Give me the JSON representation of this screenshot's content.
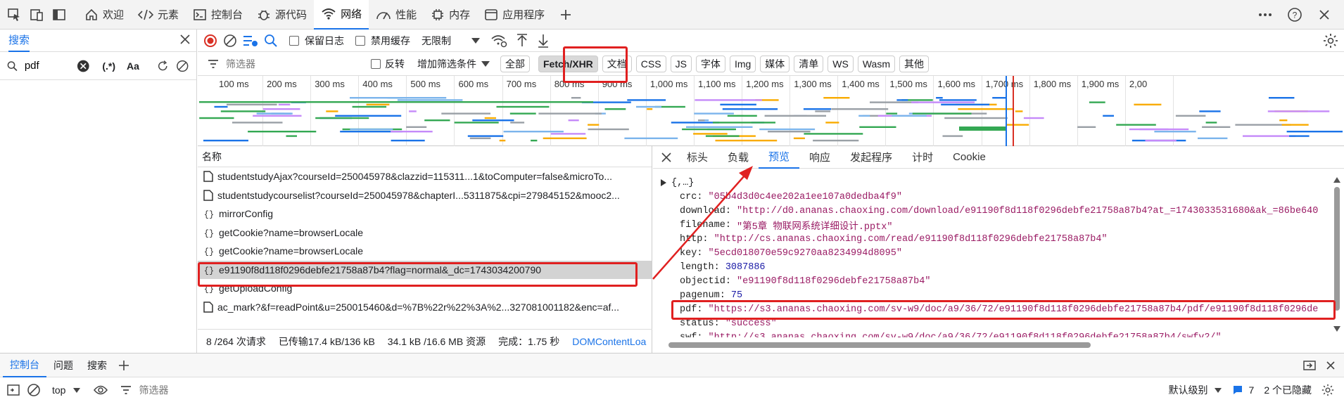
{
  "colors": {
    "accent": "#1a73e8",
    "annotation": "#e02020",
    "string": "#9a1b64",
    "number": "#1a1aa6"
  },
  "top_tabs": [
    {
      "label": "欢迎",
      "icon": "home-icon"
    },
    {
      "label": "元素",
      "icon": "code-icon"
    },
    {
      "label": "控制台",
      "icon": "console-icon"
    },
    {
      "label": "源代码",
      "icon": "bug-icon"
    },
    {
      "label": "网络",
      "icon": "wifi-icon",
      "active": true
    },
    {
      "label": "性能",
      "icon": "gauge-icon"
    },
    {
      "label": "内存",
      "icon": "chip-icon"
    },
    {
      "label": "应用程序",
      "icon": "window-icon"
    }
  ],
  "search_panel": {
    "tab": "搜索",
    "query": "pdf",
    "regex": "(.*)",
    "case": "Aa"
  },
  "toolbar": {
    "preserve_log": "保留日志",
    "disable_cache": "禁用缓存",
    "throttle": "无限制"
  },
  "filter": {
    "placeholder": "筛选器",
    "invert": "反转",
    "more": "增加筛选条件",
    "types": [
      "全部",
      "Fetch/XHR",
      "文档",
      "CSS",
      "JS",
      "字体",
      "Img",
      "媒体",
      "清单",
      "WS",
      "Wasm",
      "其他"
    ],
    "selected": "Fetch/XHR"
  },
  "timeline_ticks": [
    "100 ms",
    "200 ms",
    "300 ms",
    "400 ms",
    "500 ms",
    "600 ms",
    "700 ms",
    "800 ms",
    "900 ms",
    "1,000 ms",
    "1,100 ms",
    "1,200 ms",
    "1,300 ms",
    "1,400 ms",
    "1,500 ms",
    "1,600 ms",
    "1,700 ms",
    "1,800 ms",
    "1,900 ms",
    "2,00"
  ],
  "requests": {
    "header": "名称",
    "items": [
      {
        "name": "studentstudyAjax?courseId=250045978&clazzid=115311...1&toComputer=false&microTo...",
        "icon": "document-icon"
      },
      {
        "name": "studentstudycourselist?courseId=250045978&chapterI...5311875&cpi=279845152&mooc2...",
        "icon": "document-icon"
      },
      {
        "name": "mirrorConfig",
        "icon": "json-icon"
      },
      {
        "name": "getCookie?name=browserLocale",
        "icon": "json-icon"
      },
      {
        "name": "getCookie?name=browserLocale",
        "icon": "json-icon"
      },
      {
        "name": "e91190f8d118f0296debfe21758a87b4?flag=normal&_dc=1743034200790",
        "icon": "json-icon",
        "selected": true
      },
      {
        "name": "getUploadConfig",
        "icon": "json-icon"
      },
      {
        "name": "ac_mark?&f=readPoint&u=250015460&d=%7B%22r%22%3A%2...327081001182&enc=af...",
        "icon": "document-icon"
      }
    ],
    "status": [
      "8 /264 次请求",
      "已传输17.4 kB/136 kB",
      "34.1 kB /16.6 MB 资源",
      "完成：1.75 秒",
      "DOMContentLoa"
    ]
  },
  "detail": {
    "tabs": [
      "标头",
      "负载",
      "预览",
      "响应",
      "发起程序",
      "计时",
      "Cookie"
    ],
    "active": "预览",
    "root": "{,…}",
    "fields": [
      {
        "key": "crc",
        "value": "\"05b4d3d0c4ee202a1ee107a0dedba4f9\"",
        "kind": "string"
      },
      {
        "key": "download",
        "value": "\"http://d0.ananas.chaoxing.com/download/e91190f8d118f0296debfe21758a87b4?at_=1743033531680&ak_=86be640",
        "kind": "string"
      },
      {
        "key": "filename",
        "value": "\"第5章 物联网系统详细设计.pptx\"",
        "kind": "string"
      },
      {
        "key": "http",
        "value": "\"http://cs.ananas.chaoxing.com/read/e91190f8d118f0296debfe21758a87b4\"",
        "kind": "string"
      },
      {
        "key": "key",
        "value": "\"5ecd018070e59c9270aa8234994d8095\"",
        "kind": "string"
      },
      {
        "key": "length",
        "value": "3087886",
        "kind": "number"
      },
      {
        "key": "objectid",
        "value": "\"e91190f8d118f0296debfe21758a87b4\"",
        "kind": "string"
      },
      {
        "key": "pagenum",
        "value": "75",
        "kind": "number"
      },
      {
        "key": "pdf",
        "value": "\"https://s3.ananas.chaoxing.com/sv-w9/doc/a9/36/72/e91190f8d118f0296debfe21758a87b4/pdf/e91190f8d118f0296de",
        "kind": "string"
      },
      {
        "key": "status",
        "value": "\"success\"",
        "kind": "string"
      },
      {
        "key": "swf",
        "value": "\"http://s3.ananas.chaoxing.com/sv-w9/doc/a9/36/72/e91190f8d118f0296debfe21758a87b4/swfv2/\"",
        "kind": "string"
      }
    ]
  },
  "drawer": {
    "tabs": [
      "控制台",
      "问题",
      "搜索"
    ],
    "context": "top",
    "filter_placeholder": "筛选器",
    "level": "默认级别",
    "issues": "7",
    "hidden": "2 个已隐藏"
  }
}
